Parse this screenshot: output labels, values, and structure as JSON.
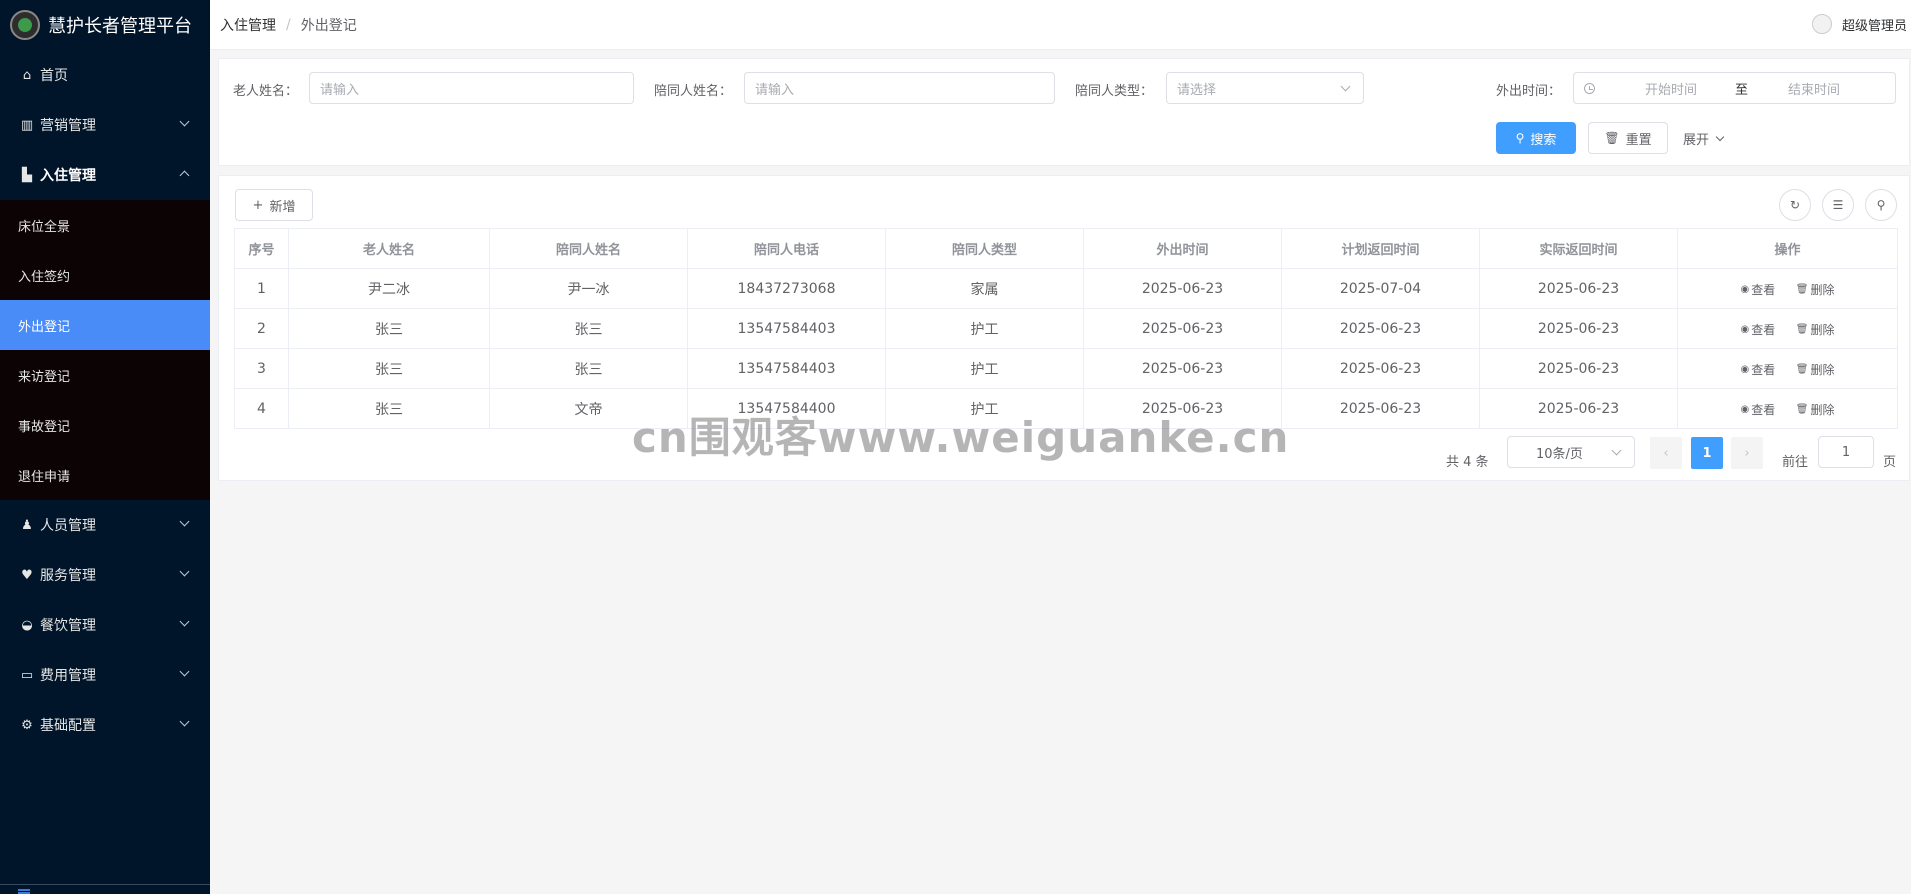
{
  "app": {
    "title": "慧护长者管理平台"
  },
  "sidebar": {
    "items": [
      {
        "label": "首页",
        "icon": "home-icon"
      },
      {
        "label": "营销管理",
        "icon": "chart-icon"
      },
      {
        "label": "入住管理",
        "icon": "building-icon"
      },
      {
        "label": "人员管理",
        "icon": "user-icon"
      },
      {
        "label": "服务管理",
        "icon": "heart-icon"
      },
      {
        "label": "餐饮管理",
        "icon": "bowl-icon"
      },
      {
        "label": "费用管理",
        "icon": "card-icon"
      },
      {
        "label": "基础配置",
        "icon": "gear-icon"
      }
    ],
    "submenu": [
      {
        "label": "床位全景"
      },
      {
        "label": "入住签约"
      },
      {
        "label": "外出登记"
      },
      {
        "label": "来访登记"
      },
      {
        "label": "事故登记"
      },
      {
        "label": "退住申请"
      }
    ]
  },
  "header": {
    "breadcrumb": [
      "入住管理",
      "/",
      "外出登记"
    ],
    "user": "超级管理员"
  },
  "search": {
    "elder_name_label": "老人姓名：",
    "elder_name_placeholder": "请输入",
    "companion_name_label": "陪同人姓名：",
    "companion_name_placeholder": "请输入",
    "companion_type_label": "陪同人类型：",
    "companion_type_placeholder": "请选择",
    "out_time_label": "外出时间：",
    "start_placeholder": "开始时间",
    "range_sep": "至",
    "end_placeholder": "结束时间",
    "search_button": "搜索",
    "reset_button": "重置",
    "expand": "展开"
  },
  "toolbar": {
    "add_button": "新增"
  },
  "table": {
    "headers": [
      "序号",
      "老人姓名",
      "陪同人姓名",
      "陪同人电话",
      "陪同人类型",
      "外出时间",
      "计划返回时间",
      "实际返回时间",
      "操作"
    ],
    "rows": [
      [
        "1",
        "尹二冰",
        "尹一冰",
        "18437273068",
        "家属",
        "2025-06-23",
        "2025-07-04",
        "2025-06-23"
      ],
      [
        "2",
        "张三",
        "张三",
        "13547584403",
        "护工",
        "2025-06-23",
        "2025-06-23",
        "2025-06-23"
      ],
      [
        "3",
        "张三",
        "张三",
        "13547584403",
        "护工",
        "2025-06-23",
        "2025-06-23",
        "2025-06-23"
      ],
      [
        "4",
        "张三",
        "文帝",
        "13547584400",
        "护工",
        "2025-06-23",
        "2025-06-23",
        "2025-06-23"
      ]
    ],
    "actions": {
      "view": "查看",
      "delete": "删除"
    }
  },
  "pagination": {
    "total": "共 4 条",
    "page_size": "10条/页",
    "current_page": "1",
    "goto_label": "前往",
    "goto_value": "1",
    "page_suffix": "页"
  },
  "watermark": "cn围观客www.weiguanke.cn",
  "colors": {
    "primary": "#409eff",
    "sidebar": "#001529",
    "active_menu": "#4a8cf7"
  }
}
